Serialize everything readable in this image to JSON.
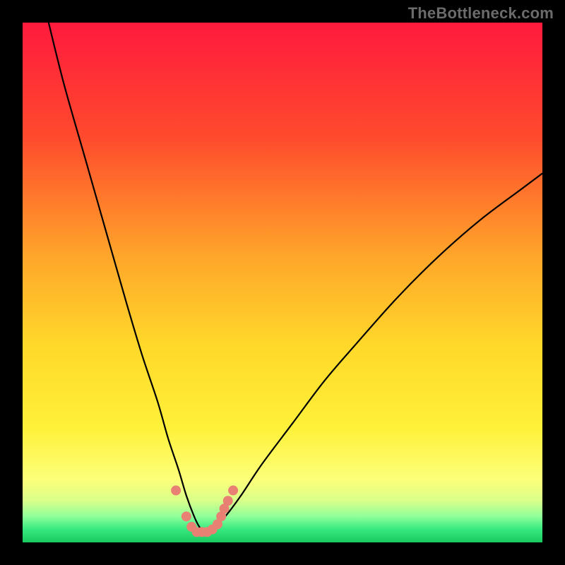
{
  "watermark": "TheBottleneck.com",
  "chart_data": {
    "type": "line",
    "title": "",
    "xlabel": "",
    "ylabel": "",
    "xlim": [
      0,
      100
    ],
    "ylim": [
      0,
      100
    ],
    "grid": false,
    "legend": false,
    "gradient_stops": [
      {
        "offset": 0.0,
        "color": "#ff1a3d"
      },
      {
        "offset": 0.22,
        "color": "#ff4a2d"
      },
      {
        "offset": 0.45,
        "color": "#ffa62a"
      },
      {
        "offset": 0.62,
        "color": "#ffd82a"
      },
      {
        "offset": 0.78,
        "color": "#fff13a"
      },
      {
        "offset": 0.88,
        "color": "#fcff7a"
      },
      {
        "offset": 0.92,
        "color": "#d9ff8a"
      },
      {
        "offset": 0.95,
        "color": "#8fff9a"
      },
      {
        "offset": 0.975,
        "color": "#36e97e"
      },
      {
        "offset": 1.0,
        "color": "#18c95f"
      }
    ],
    "series": [
      {
        "name": "bottleneck-curve",
        "color": "#000000",
        "x": [
          5,
          8,
          12,
          16,
          20,
          23,
          26,
          28,
          30,
          31.5,
          33,
          34,
          35,
          36,
          37,
          39,
          42,
          46,
          52,
          58,
          64,
          72,
          80,
          88,
          96,
          100
        ],
        "y": [
          100,
          88,
          74,
          60,
          46,
          36,
          27,
          20,
          14,
          9,
          5,
          3,
          2,
          2,
          3,
          5,
          9,
          15,
          23,
          31,
          38,
          47,
          55,
          62,
          68,
          71
        ]
      }
    ],
    "markers": {
      "name": "highlight-points",
      "color": "#e98074",
      "radius_px": 7,
      "x": [
        29.5,
        31.5,
        32.5,
        33.5,
        34.5,
        35.5,
        36.5,
        37.5,
        38.2,
        38.8,
        39.5,
        40.5
      ],
      "y": [
        10,
        5,
        3,
        2,
        2,
        2,
        2.5,
        3.5,
        5,
        6.5,
        8,
        10
      ]
    }
  }
}
